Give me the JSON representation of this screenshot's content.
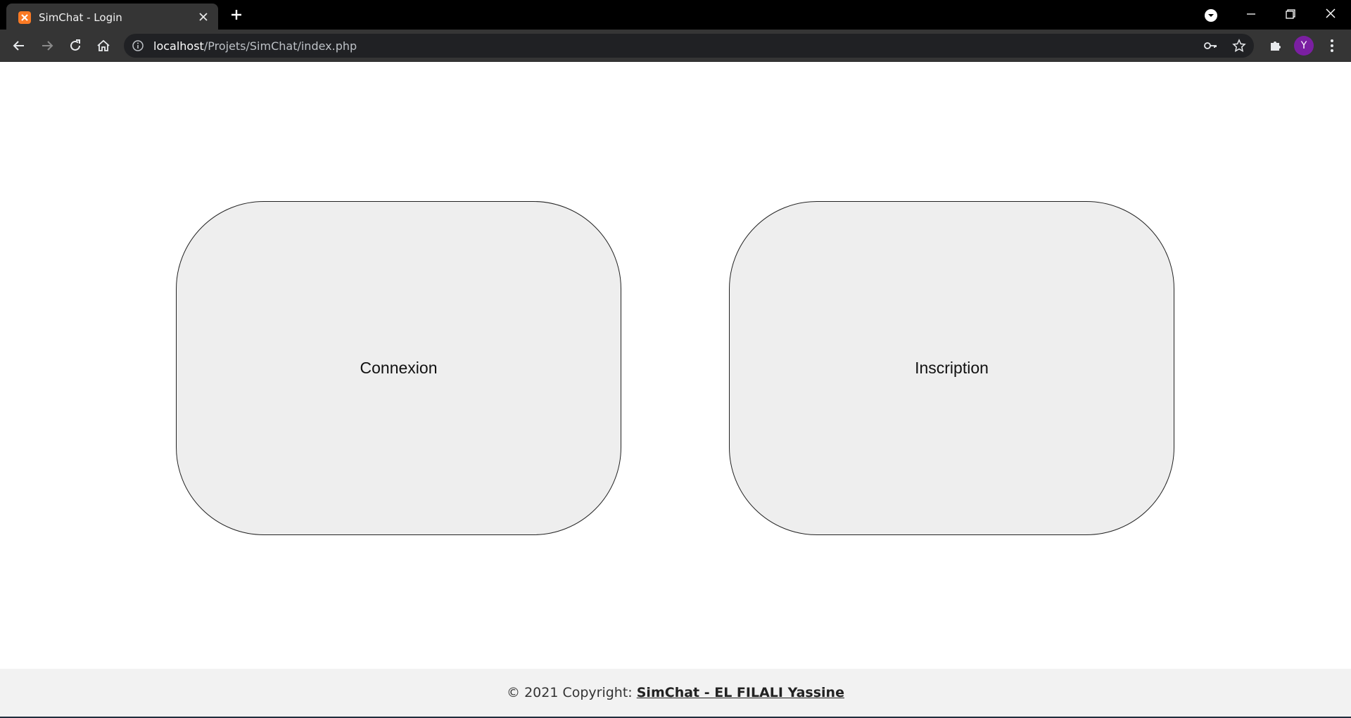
{
  "browser": {
    "tab_title": "SimChat - Login",
    "url_host": "localhost",
    "url_path": "/Projets/SimChat/index.php",
    "profile_initial": "Y",
    "colors": {
      "favicon": "#fb7a24",
      "avatar": "#7b1fa2"
    }
  },
  "main": {
    "cards": [
      {
        "label": "Connexion"
      },
      {
        "label": "Inscription"
      }
    ]
  },
  "footer": {
    "prefix": "© 2021 Copyright: ",
    "link_text": "SimChat - EL FILALI Yassine"
  }
}
